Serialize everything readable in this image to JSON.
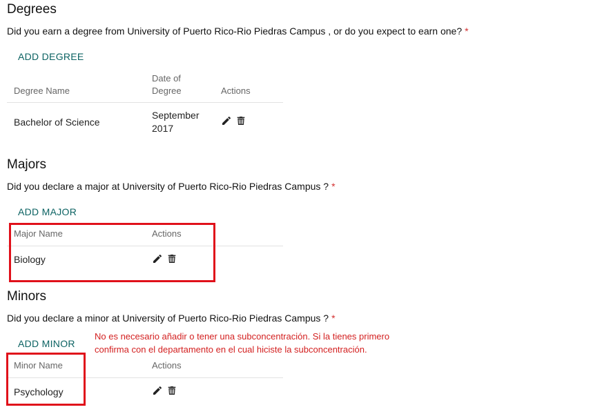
{
  "degrees": {
    "heading": "Degrees",
    "question": "Did you earn a degree from University of Puerto Rico-Rio Piedras Campus , or do you expect to earn one?",
    "required_mark": "*",
    "add_label": "ADD DEGREE",
    "headers": {
      "name": "Degree Name",
      "date_line1": "Date of",
      "date_line2": "Degree",
      "actions": "Actions"
    },
    "rows": [
      {
        "name": "Bachelor of Science",
        "date_line1": "September",
        "date_line2": "2017"
      }
    ]
  },
  "majors": {
    "heading": "Majors",
    "question": "Did you declare a major at University of Puerto Rico-Rio Piedras Campus ?",
    "required_mark": "*",
    "add_label": "ADD MAJOR",
    "headers": {
      "name": "Major Name",
      "actions": "Actions"
    },
    "rows": [
      {
        "name": "Biology"
      }
    ]
  },
  "minors": {
    "heading": "Minors",
    "question": "Did you declare a minor at University of Puerto Rico-Rio Piedras Campus ?",
    "required_mark": "*",
    "add_label": "ADD MINOR",
    "headers": {
      "name": "Minor Name",
      "actions": "Actions"
    },
    "rows": [
      {
        "name": "Psychology"
      }
    ]
  },
  "annotation": {
    "line1": "No es necesario añadir o tener una subconcentración. Si la tienes primero",
    "line2": "confirma con el departamento en el cual hiciste la subconcentración.",
    "color": "#d31f1f"
  },
  "colors": {
    "accent": "#0b6262",
    "required": "#d32f2f",
    "highlight_box": "#e0101a"
  },
  "icons": {
    "edit": "pencil-icon",
    "delete": "trash-icon"
  }
}
